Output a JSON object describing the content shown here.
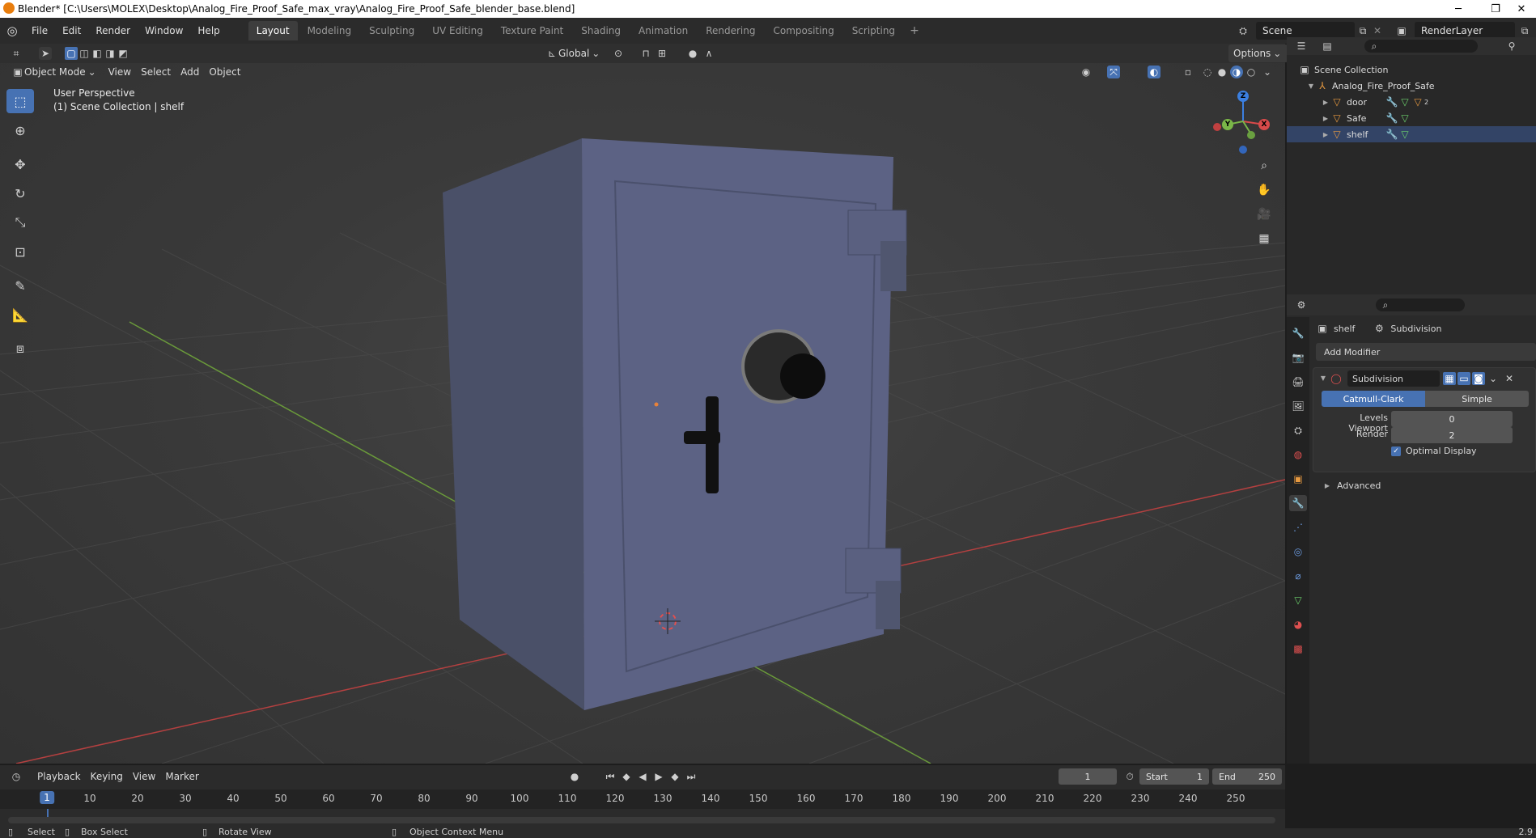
{
  "window": {
    "title": "Blender* [C:\\Users\\MOLEX\\Desktop\\Analog_Fire_Proof_Safe_max_vray\\Analog_Fire_Proof_Safe_blender_base.blend]",
    "minimize": "─",
    "maximize": "❐",
    "close": "✕"
  },
  "menu": {
    "items": [
      "File",
      "Edit",
      "Render",
      "Window",
      "Help"
    ]
  },
  "workspaces": {
    "tabs": [
      "Layout",
      "Modeling",
      "Sculpting",
      "UV Editing",
      "Texture Paint",
      "Shading",
      "Animation",
      "Rendering",
      "Compositing",
      "Scripting"
    ],
    "active": "Layout",
    "add": "+"
  },
  "scene": {
    "scene_name": "Scene",
    "view_layer": "RenderLayer"
  },
  "viewport_header": {
    "mode": "Object Mode",
    "menus": [
      "View",
      "Select",
      "Add",
      "Object"
    ],
    "orientation": "Global",
    "options": "Options"
  },
  "viewport": {
    "perspective_label": "User Perspective",
    "collection_label": "(1) Scene Collection | shelf"
  },
  "gizmo": {
    "z": "Z",
    "y": "Y",
    "x": "X"
  },
  "outliner": {
    "root": "Scene Collection",
    "collection": "Analog_Fire_Proof_Safe",
    "objects": [
      {
        "name": "door",
        "badge": "2"
      },
      {
        "name": "Safe",
        "badge": ""
      },
      {
        "name": "shelf",
        "badge": ""
      }
    ]
  },
  "properties": {
    "object_name": "shelf",
    "modifier_context": "Subdivision",
    "add_modifier": "Add Modifier",
    "modifier": {
      "name": "Subdivision",
      "types": [
        "Catmull-Clark",
        "Simple"
      ],
      "active_type": "Catmull-Clark",
      "levels_viewport_label": "Levels Viewport",
      "levels_viewport": "0",
      "render_label": "Render",
      "render": "2",
      "optimal_display_label": "Optimal Display",
      "optimal_display": true,
      "advanced": "Advanced"
    }
  },
  "timeline": {
    "menus": [
      "Playback",
      "Keying",
      "View",
      "Marker"
    ],
    "current_frame": "1",
    "start_label": "Start",
    "start": "1",
    "end_label": "End",
    "end": "250",
    "ruler": [
      "1",
      "10",
      "20",
      "30",
      "40",
      "50",
      "60",
      "70",
      "80",
      "90",
      "100",
      "110",
      "120",
      "130",
      "140",
      "150",
      "160",
      "170",
      "180",
      "190",
      "200",
      "210",
      "220",
      "230",
      "240",
      "250"
    ]
  },
  "statusbar": {
    "select": "Select",
    "box_select": "Box Select",
    "rotate_view": "Rotate View",
    "context_menu": "Object Context Menu",
    "version": "2.9"
  },
  "colors": {
    "accent": "#4772b3",
    "safe_body": "#5a5f7a",
    "axis_x": "#d84a4a",
    "axis_y": "#7ab648",
    "axis_z": "#3b7fe0"
  }
}
